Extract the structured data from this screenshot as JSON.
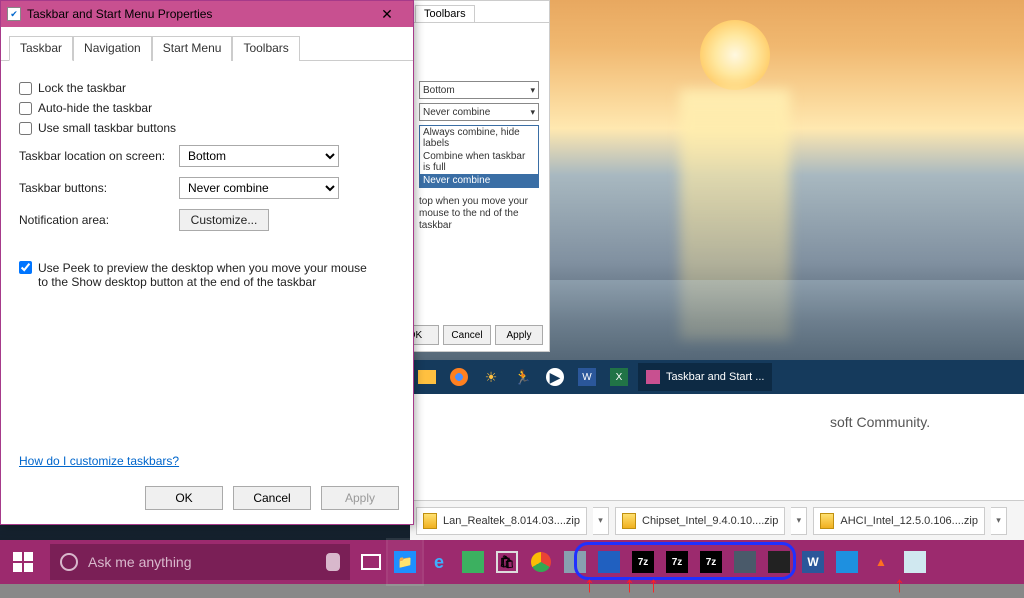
{
  "dialog": {
    "title": "Taskbar and Start Menu Properties",
    "tabs": [
      "Taskbar",
      "Navigation",
      "Start Menu",
      "Toolbars"
    ],
    "lock": "Lock the taskbar",
    "autohide": "Auto-hide the taskbar",
    "smallbtn": "Use small taskbar buttons",
    "loc_label": "Taskbar location on screen:",
    "loc_value": "Bottom",
    "btns_label": "Taskbar buttons:",
    "btns_value": "Never combine",
    "notif_label": "Notification area:",
    "notif_btn": "Customize...",
    "peek": "Use Peek to preview the desktop when you move your mouse to the Show desktop button at the end of the taskbar",
    "help_link": "How do I customize taskbars?",
    "ok": "OK",
    "cancel": "Cancel",
    "apply": "Apply"
  },
  "dialog2": {
    "tab": "Toolbars",
    "sel1": "Bottom",
    "sel2": "Never combine",
    "opts": [
      "Always combine, hide labels",
      "Combine when taskbar is full",
      "Never combine"
    ],
    "peek_tail": "top when you move your mouse to the nd of the taskbar",
    "ok": "OK",
    "cancel": "Cancel",
    "apply": "Apply"
  },
  "inner_taskbar": {
    "task_label": "Taskbar and Start ..."
  },
  "page": {
    "text": "soft Community."
  },
  "downloads": [
    "Lan_Realtek_8.014.03....zip",
    "Chipset_Intel_9.4.0.10....zip",
    "AHCI_Intel_12.5.0.106....zip"
  ],
  "search_placeholder": "Ask me anything"
}
